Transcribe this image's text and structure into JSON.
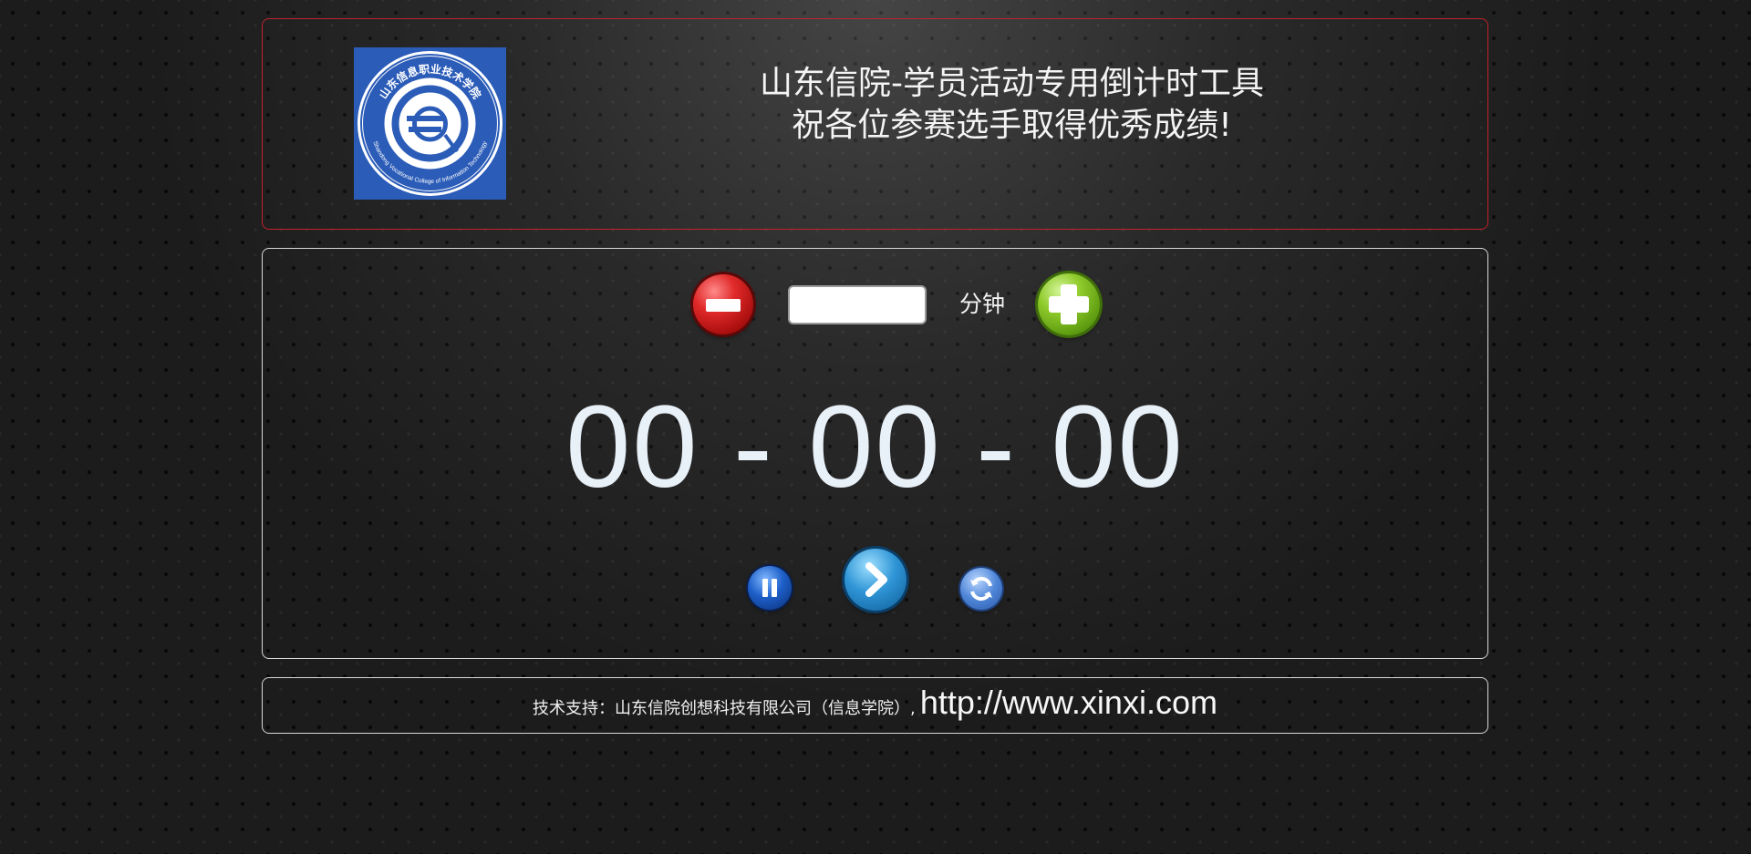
{
  "header": {
    "logo_text_top": "山东信息职业技术学院",
    "logo_text_bottom": "Shandong Vocational College of Information Technology",
    "title_line1": "山东信院-学员活动专用倒计时工具",
    "title_line2": "祝各位参赛选手取得优秀成绩!"
  },
  "timer": {
    "minutes_value": "",
    "unit_label": "分钟",
    "hours": "00",
    "separator1": "-",
    "minutes": "00",
    "separator2": "-",
    "seconds": "00"
  },
  "footer": {
    "support_text": "技术支持：山东信院创想科技有限公司（信息学院）,",
    "link_text": "http://www.xinxi.com"
  },
  "icons": {
    "decrease": "minus-icon",
    "increase": "plus-icon",
    "pause": "pause-icon",
    "start": "chevron-right-icon",
    "reset": "refresh-icon"
  },
  "colors": {
    "header_border": "#c0232b",
    "panel_border": "#d8d8d8",
    "logo_bg": "#2b5cb8",
    "countdown_text": "#e8f0f8"
  }
}
